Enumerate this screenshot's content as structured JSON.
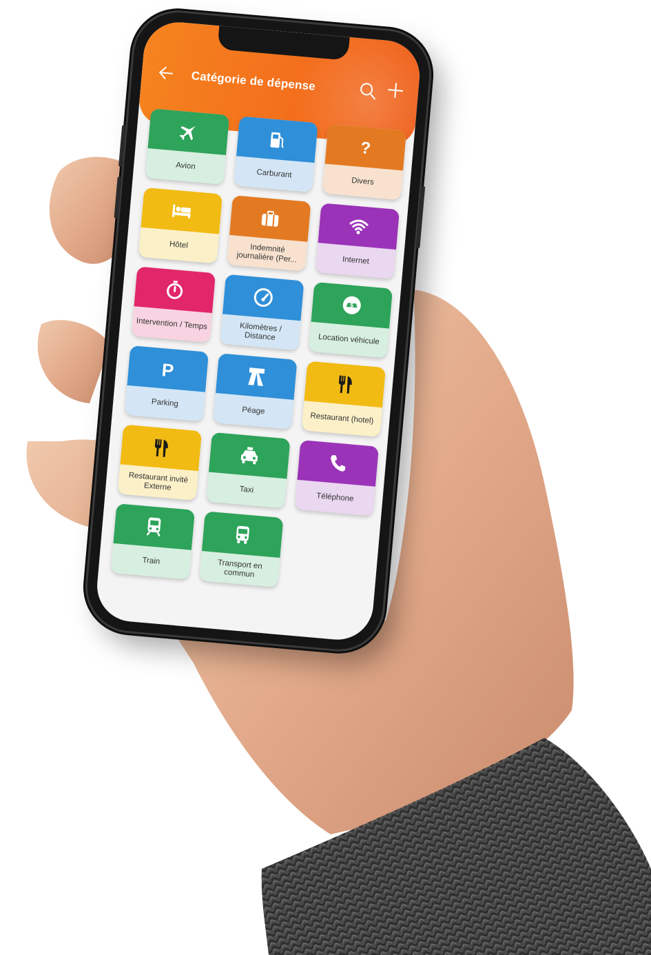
{
  "app": {
    "title": "Catégorie de dépense",
    "back_icon": "arrow-left-icon",
    "search_icon": "search-icon",
    "add_icon": "plus-icon",
    "header_color": "#f36d1c"
  },
  "categories": [
    {
      "label": "Avion",
      "icon": "plane-icon",
      "color": "#2ea35a",
      "tint": "#d7efe0"
    },
    {
      "label": "Carburant",
      "icon": "fuel-pump-icon",
      "color": "#2f8fd8",
      "tint": "#d4e6f5"
    },
    {
      "label": "Divers",
      "icon": "question-icon",
      "color": "#e37a22",
      "tint": "#f8e2cf"
    },
    {
      "label": "Hôtel",
      "icon": "bed-icon",
      "color": "#f2bb13",
      "tint": "#fbf0c8"
    },
    {
      "label": "Indemnité journalière (Per...",
      "icon": "suitcase-icon",
      "color": "#e37a22",
      "tint": "#f8e2cf"
    },
    {
      "label": "Internet",
      "icon": "wifi-icon",
      "color": "#9b33b8",
      "tint": "#ead7f0"
    },
    {
      "label": "Intervention / Temps",
      "icon": "stopwatch-icon",
      "color": "#e2266a",
      "tint": "#f8d3e1"
    },
    {
      "label": "Kilomètres / Distance",
      "icon": "speedometer-icon",
      "color": "#2f8fd8",
      "tint": "#d4e6f5"
    },
    {
      "label": "Location véhicule",
      "icon": "car-rental-icon",
      "color": "#2ea35a",
      "tint": "#d7efe0"
    },
    {
      "label": "Parking",
      "icon": "parking-icon",
      "color": "#2f8fd8",
      "tint": "#d4e6f5"
    },
    {
      "label": "Péage",
      "icon": "toll-road-icon",
      "color": "#2f8fd8",
      "tint": "#d4e6f5"
    },
    {
      "label": "Restaurant (hotel)",
      "icon": "fork-knife-icon",
      "color": "#f2bb13",
      "tint": "#fbf0c8"
    },
    {
      "label": "Restaurant invité Externe",
      "icon": "fork-knife-icon",
      "color": "#f2bb13",
      "tint": "#fbf0c8"
    },
    {
      "label": "Taxi",
      "icon": "taxi-icon",
      "color": "#2ea35a",
      "tint": "#d7efe0"
    },
    {
      "label": "Téléphone",
      "icon": "phone-icon",
      "color": "#9b33b8",
      "tint": "#ead7f0"
    },
    {
      "label": "Train",
      "icon": "train-icon",
      "color": "#2ea35a",
      "tint": "#d7efe0"
    },
    {
      "label": "Transport en commun",
      "icon": "bus-icon",
      "color": "#2ea35a",
      "tint": "#d7efe0"
    }
  ]
}
